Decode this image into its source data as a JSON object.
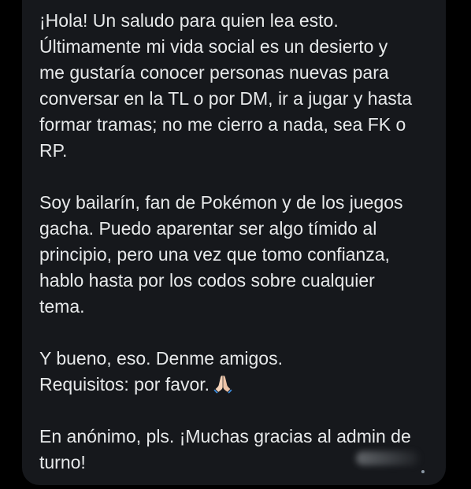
{
  "message": {
    "paragraphs": [
      {
        "lines": [
          "¡Hola! Un saludo para quien lea esto.",
          "Últimamente mi vida social es un desierto y",
          "me gustaría conocer personas nuevas para",
          "conversar en la TL o por DM, ir a jugar y hasta",
          "formar tramas; no me cierro a nada, sea FK o",
          "RP."
        ]
      },
      {
        "lines": [
          "Soy bailarín, fan de Pokémon y de los juegos",
          "gacha. Puedo aparentar ser algo tímido al",
          "principio, pero una vez que tomo confianza,",
          "hablo hasta por los codos sobre cualquier",
          "tema."
        ]
      },
      {
        "lines": [
          "Y bueno, eso. Denme amigos.",
          "Requisitos: por favor."
        ]
      },
      {
        "lines": [
          "En anónimo, pls. ¡Muchas gracias al admin de",
          "turno!"
        ]
      }
    ]
  },
  "icons": {
    "folded_hands": "folded-hands-emoji"
  },
  "colors": {
    "background": "#000000",
    "bubble": "#16181c",
    "text": "#e7e9ea",
    "muted": "#8b98a5"
  }
}
